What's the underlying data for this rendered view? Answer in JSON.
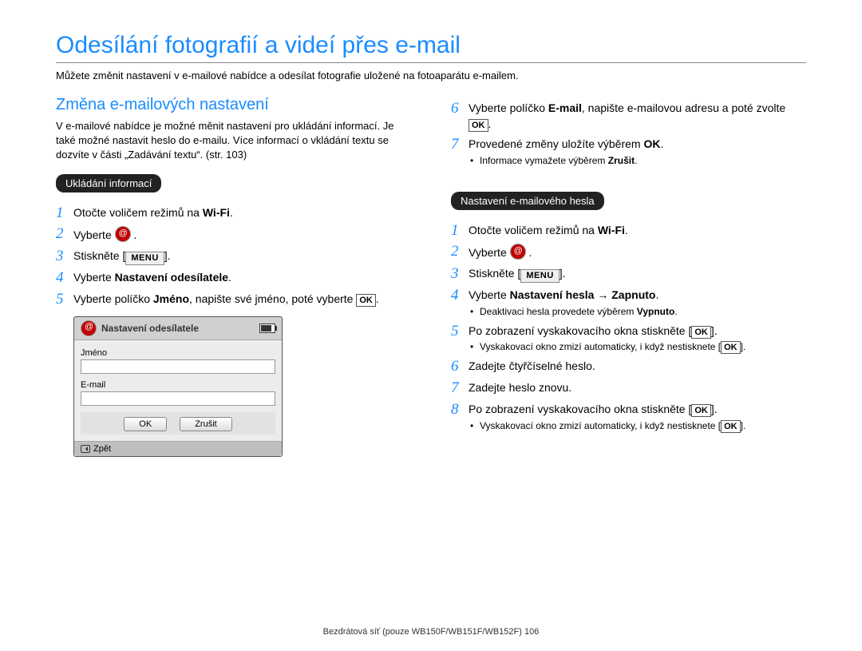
{
  "title": "Odesílání fotografií a videí přes e-mail",
  "intro": "Můžete změnit nastavení v e-mailové nabídce a odesílat fotografie uložené na fotoaparátu e-mailem.",
  "left": {
    "heading": "Změna e-mailových nastavení",
    "para": "V e-mailové nabídce je možné měnit nastavení pro ukládání informací. Je také možné nastavit heslo do e-mailu. Více informací o vkládání textu se dozvíte v části „Zadávání textu“. (str. 103)",
    "pill": "Ukládání informací",
    "step1_a": "Otočte voličem režimů na ",
    "wifi": "Wi-Fi",
    "step1_b": ".",
    "step2_a": "Vyberte ",
    "step2_b": ".",
    "step3_a": "Stiskněte ",
    "menu": "MENU",
    "step3_b": ".",
    "step4_a": "Vyberte ",
    "step4_bold": "Nastavení odesílatele",
    "step4_b": ".",
    "step5_a": "Vyberte políčko ",
    "step5_bold": "Jméno",
    "step5_b": ", napište své jméno, poté vyberte ",
    "ok_glyph": "OK",
    "step5_c": "."
  },
  "mock": {
    "title": "Nastavení odesílatele",
    "field1": "Jméno",
    "field2": "E-mail",
    "ok": "OK",
    "cancel": "Zrušit",
    "back": "Zpět"
  },
  "rightA": {
    "step6_a": "Vyberte políčko ",
    "step6_bold": "E-mail",
    "step6_b": ", napište e-mailovou adresu a poté zvolte ",
    "step6_c": ".",
    "step7_a": "Provedené změny uložíte výběrem ",
    "step7_bold": "OK",
    "step7_b": ".",
    "step7_sub_a": "Informace vymažete výběrem ",
    "step7_sub_bold": "Zrušit",
    "step7_sub_b": "."
  },
  "rightB": {
    "pill": "Nastavení e-mailového hesla",
    "step1_a": "Otočte voličem režimů na ",
    "step1_b": ".",
    "step2_a": "Vyberte ",
    "step2_b": ".",
    "step3_a": "Stiskněte ",
    "step3_b": ".",
    "step4_a": "Vyberte ",
    "step4_bold": "Nastavení hesla",
    "step4_arrow": " → ",
    "step4_bold2": "Zapnuto",
    "step4_b": ".",
    "step4_sub_a": "Deaktivaci hesla provedete výběrem ",
    "step4_sub_bold": "Vypnuto",
    "step4_sub_b": ".",
    "step5_a": "Po zobrazení vyskakovacího okna stiskněte [",
    "step5_b": "].",
    "step5_sub_a": "Vyskakovací okno zmizí automaticky, i když nestisknete [",
    "step5_sub_b": "].",
    "step6": "Zadejte čtyřčíselné heslo.",
    "step7": "Zadejte heslo znovu.",
    "step8_a": "Po zobrazení vyskakovacího okna stiskněte [",
    "step8_b": "].",
    "step8_sub_a": "Vyskakovací okno zmizí automaticky, i když nestisknete [",
    "step8_sub_b": "]."
  },
  "footer_a": "Bezdrátová síť  (pouze WB150F/WB151F/WB152F)  ",
  "footer_b": "106"
}
